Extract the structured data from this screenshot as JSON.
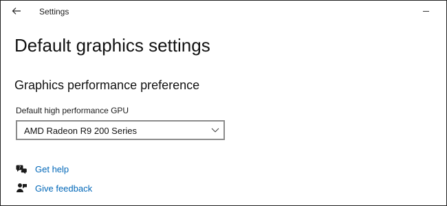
{
  "window": {
    "title": "Settings"
  },
  "page": {
    "title": "Default graphics settings",
    "section_title": "Graphics performance preference"
  },
  "gpu_setting": {
    "label": "Default high performance GPU",
    "selected_value": "AMD Radeon R9 200 Series"
  },
  "links": [
    {
      "label": "Get help",
      "icon": "help-chat-icon"
    },
    {
      "label": "Give feedback",
      "icon": "feedback-icon"
    }
  ],
  "colors": {
    "link": "#0067b8",
    "text": "#1a1a1a",
    "background": "#ffffff"
  }
}
